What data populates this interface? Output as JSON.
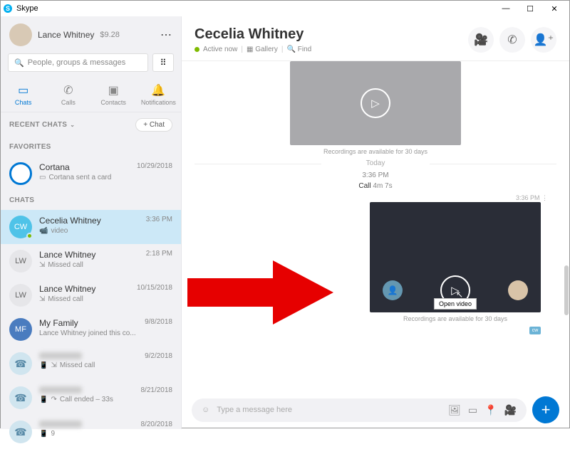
{
  "window": {
    "title": "Skype"
  },
  "profile": {
    "name": "Lance Whitney",
    "credit": "$9.28"
  },
  "search": {
    "placeholder": "People, groups & messages"
  },
  "tabs": [
    {
      "label": "Chats",
      "icon": "💬",
      "active": true
    },
    {
      "label": "Calls",
      "icon": "📞"
    },
    {
      "label": "Contacts",
      "icon": "👤"
    },
    {
      "label": "Notifications",
      "icon": "🔔"
    }
  ],
  "sections": {
    "recent": "RECENT CHATS",
    "favorites": "FAVORITES",
    "chats": "CHATS",
    "new_chat": "Chat"
  },
  "contacts": {
    "cortana": {
      "name": "Cortana",
      "time": "10/29/2018",
      "sub": "Cortana sent a card"
    },
    "cecelia": {
      "name": "Cecelia Whitney",
      "time": "3:36 PM",
      "sub": "video"
    },
    "lance1": {
      "name": "Lance Whitney",
      "time": "2:18 PM",
      "sub": "Missed call"
    },
    "lance2": {
      "name": "Lance Whitney",
      "time": "10/15/2018",
      "sub": "Missed call"
    },
    "family": {
      "name": "My Family",
      "time": "9/8/2018",
      "sub": "Lance Whitney joined this co..."
    },
    "anon1": {
      "time": "9/2/2018",
      "sub": "Missed call"
    },
    "anon2": {
      "time": "8/21/2018",
      "sub": "Call ended – 33s"
    },
    "anon3": {
      "time": "8/20/2018",
      "sub": "9"
    }
  },
  "chat": {
    "title": "Cecelia Whitney",
    "status": "Active now",
    "gallery": "Gallery",
    "find": "Find",
    "recording_note": "Recordings are available for 30 days",
    "divider": "Today",
    "call_time": "3:36 PM",
    "call_label": "Call",
    "call_duration": "4m 7s",
    "msg_time": "3:36 PM",
    "tooltip": "Open video",
    "self_badge": "cw"
  },
  "composer": {
    "placeholder": "Type a message here"
  }
}
